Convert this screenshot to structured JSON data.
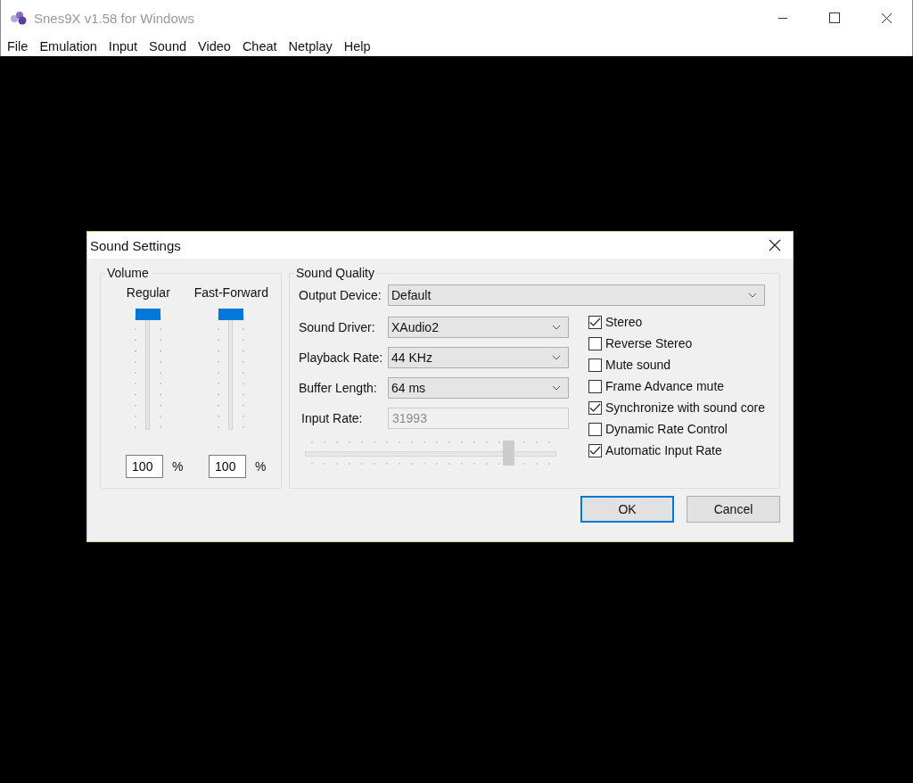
{
  "window": {
    "title": "Snes9X v1.58 for Windows"
  },
  "menu": [
    "File",
    "Emulation",
    "Input",
    "Sound",
    "Video",
    "Cheat",
    "Netplay",
    "Help"
  ],
  "dialog": {
    "title": "Sound Settings",
    "volume": {
      "title": "Volume",
      "sliders": [
        {
          "label": "Regular",
          "level": 1,
          "value": "100",
          "unit": "%"
        },
        {
          "label": "Fast-Forward",
          "level": 1,
          "value": "100",
          "unit": "%"
        }
      ]
    },
    "quality": {
      "title": "Sound Quality",
      "output_device": {
        "label": "Output Device:",
        "value": "Default"
      },
      "selects": [
        {
          "label": "Sound Driver:",
          "value": "XAudio2"
        },
        {
          "label": "Playback Rate:",
          "value": "44 KHz"
        },
        {
          "label": "Buffer Length:",
          "value": "64 ms"
        }
      ],
      "input_rate": {
        "label": "Input Rate:",
        "value": "31993",
        "disabled": true,
        "level": 0.83
      },
      "options": [
        {
          "label": "Stereo",
          "checked": true
        },
        {
          "label": "Reverse Stereo",
          "checked": false
        },
        {
          "label": "Mute sound",
          "checked": false
        },
        {
          "label": "Frame Advance mute",
          "checked": false
        },
        {
          "label": "Synchronize with sound core",
          "checked": true
        },
        {
          "label": "Dynamic Rate Control",
          "checked": false
        },
        {
          "label": "Automatic Input Rate",
          "checked": true
        }
      ]
    },
    "buttons": [
      {
        "label": "OK",
        "default": true
      },
      {
        "label": "Cancel",
        "default": false
      }
    ]
  }
}
